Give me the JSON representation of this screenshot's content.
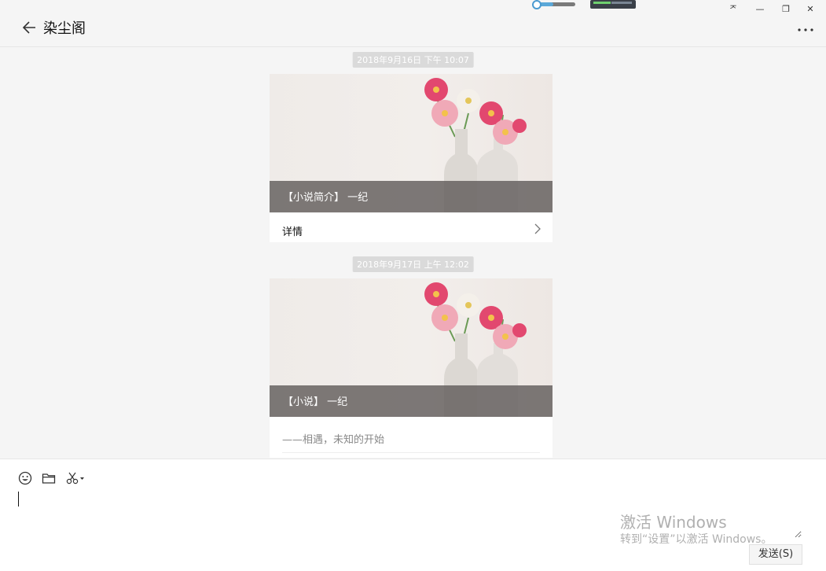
{
  "titlebar": {
    "title": "染尘阁",
    "back_icon": "arrow-left-icon",
    "more_icon": "more-horizontal-icon",
    "pin_label": "ᅎ",
    "minimize_label": "—",
    "restore_label": "❐",
    "close_label": "✕"
  },
  "messages": [
    {
      "timestamp": "2018年9月16日 下午 10:07",
      "card_title": "【小说简介】 一纪",
      "footer_label": "详情"
    },
    {
      "timestamp": "2018年9月17日 上午 12:02",
      "card_title": "【小说】 一纪",
      "summary": "——相遇，未知的开始"
    }
  ],
  "toolbar": {
    "emoji_icon": "emoji-icon",
    "folder_icon": "folder-icon",
    "screenshot_icon": "scissors-icon"
  },
  "input": {
    "value": "",
    "placeholder": ""
  },
  "watermark": {
    "line1": "激活 Windows",
    "line2": "转到“设置”以激活 Windows。"
  },
  "send_label": "发送(S)",
  "colors": {
    "background": "#f5f5f5",
    "overlay": "#625d5c",
    "timestamp_bg": "#dadada",
    "flower_pink": "#e8457a"
  }
}
